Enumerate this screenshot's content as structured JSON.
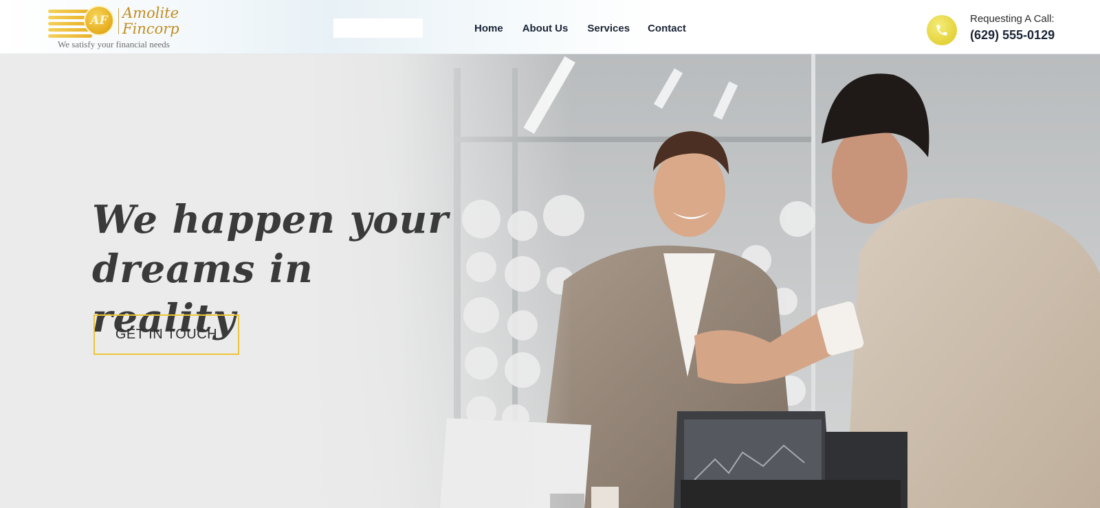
{
  "brand": {
    "emblem_text": "AF",
    "name_line1": "Amolite",
    "name_line2": "Fincorp",
    "tagline": "We satisfy your financial needs",
    "accent_color": "#E9B22A"
  },
  "nav": {
    "items": [
      {
        "label": "Home",
        "icon": null
      },
      {
        "label": "About Us",
        "icon": null
      },
      {
        "label": "Services",
        "icon": null
      },
      {
        "label": "Contact",
        "icon": null
      }
    ]
  },
  "contact": {
    "icon": "phone-icon",
    "label": "Requesting A Call:",
    "number": "(629) 555-0129",
    "icon_color": "#E6D63F"
  },
  "hero": {
    "headline_line1": "We happen your",
    "headline_line2": "dreams in reality",
    "cta_label": "GET IN TOUCH",
    "cta_border_color": "#EFC437",
    "image": "business-handshake-photo"
  }
}
